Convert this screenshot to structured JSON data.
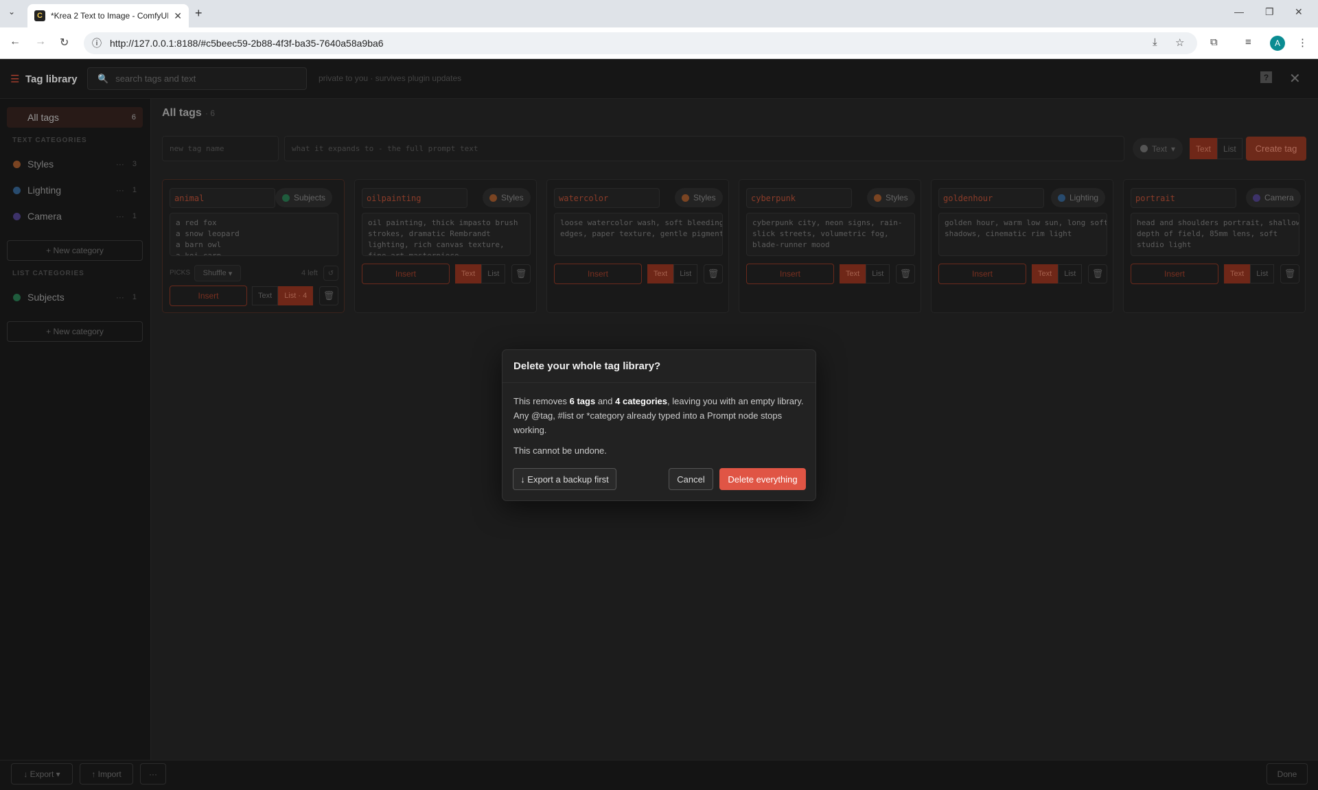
{
  "browser": {
    "tab_title": "*Krea 2 Text to Image - ComfyUI",
    "url": "http://127.0.0.1:8188/#c5beec59-2b88-4f3f-ba35-7640a58a9ba6",
    "avatar": "A"
  },
  "app": {
    "title": "Tag library",
    "search_placeholder": "search tags and text",
    "private_note": "private to you · survives plugin updates",
    "help": "?"
  },
  "sidebar": {
    "all_tags": {
      "label": "All tags",
      "count": "6"
    },
    "text_categories_heading": "TEXT CATEGORIES",
    "text_categories": [
      {
        "label": "Styles",
        "count": "3",
        "color": "#b4622b"
      },
      {
        "label": "Lighting",
        "count": "1",
        "color": "#3b6ea1"
      },
      {
        "label": "Camera",
        "count": "1",
        "color": "#5b4a9c"
      }
    ],
    "new_category": "+ New category",
    "list_categories_heading": "LIST CATEGORIES",
    "list_categories": [
      {
        "label": "Subjects",
        "count": "1",
        "color": "#2f8a5b"
      }
    ]
  },
  "main": {
    "title": "All tags",
    "count": "· 6",
    "new_tag_placeholder": "new tag name",
    "expand_placeholder": "what it expands to - the full prompt text",
    "type_select": "Text",
    "mode_text": "Text",
    "mode_list": "List",
    "create_tag": "Create tag"
  },
  "cards": [
    {
      "name": "animal",
      "category": "Subjects",
      "lines": [
        "a red fox",
        "a snow leopard",
        "a barn owl",
        "a koi carp"
      ],
      "picks_label": "PICKS",
      "picks_mode": "Shuffle",
      "left": "4 left",
      "insert": "Insert",
      "text": "Text",
      "list": "List · 4"
    },
    {
      "name": "oilpainting",
      "category": "Styles",
      "lines": [
        "oil painting, thick impasto brush",
        "strokes, dramatic Rembrandt",
        "lighting, rich canvas texture,",
        "fine art masterpiece"
      ],
      "insert": "Insert",
      "text": "Text",
      "list": "List"
    },
    {
      "name": "watercolor",
      "category": "Styles",
      "lines": [
        "loose watercolor wash, soft bleeding",
        "edges, paper texture, gentle pigment"
      ],
      "insert": "Insert",
      "text": "Text",
      "list": "List"
    },
    {
      "name": "cyberpunk",
      "category": "Styles",
      "lines": [
        "cyberpunk city, neon signs, rain-",
        "slick streets, volumetric fog,",
        "blade-runner mood"
      ],
      "insert": "Insert",
      "text": "Text",
      "list": "List"
    },
    {
      "name": "goldenhour",
      "category": "Lighting",
      "lines": [
        "golden hour, warm low sun, long soft",
        "shadows, cinematic rim light"
      ],
      "insert": "Insert",
      "text": "Text",
      "list": "List"
    },
    {
      "name": "portrait",
      "category": "Camera",
      "lines": [
        "head and shoulders portrait, shallow",
        "depth of field, 85mm lens, soft",
        "studio light"
      ],
      "insert": "Insert",
      "text": "Text",
      "list": "List"
    }
  ],
  "bottom": {
    "export": "↓ Export ▾",
    "import": "↑ Import",
    "more": "···",
    "done": "Done"
  },
  "modal": {
    "title": "Delete your whole tag library?",
    "body_pre": "This removes ",
    "tags": "6 tags",
    "and": " and ",
    "cats": "4 categories",
    "body_post": ", leaving you with an empty library. Any @tag, #list or *category already typed into a Prompt node stops working.",
    "warning": "This cannot be undone.",
    "export_backup": "↓ Export a backup first",
    "cancel": "Cancel",
    "delete": "Delete everything"
  },
  "colors": {
    "accent": "#e05545",
    "subjects": "#2f8a5b",
    "styles": "#b4622b",
    "lighting": "#3b6ea1",
    "camera": "#5b4a9c"
  }
}
